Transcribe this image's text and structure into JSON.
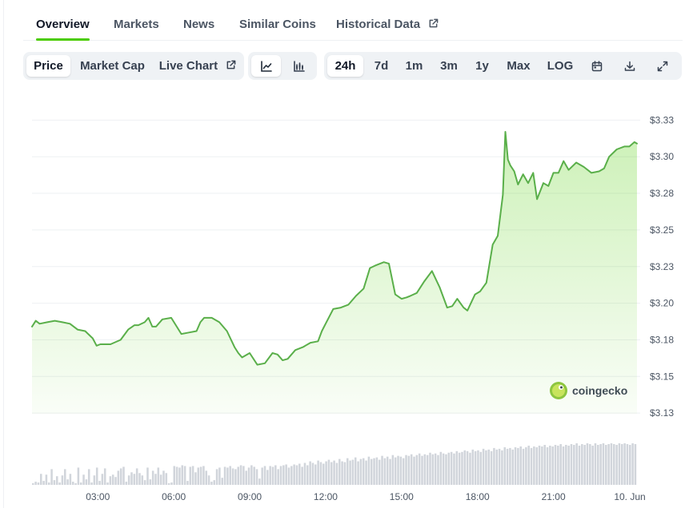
{
  "tabs": [
    {
      "label": "Overview",
      "active": true
    },
    {
      "label": "Markets"
    },
    {
      "label": "News"
    },
    {
      "label": "Similar Coins"
    },
    {
      "label": "Historical Data",
      "icon": "external-link-icon"
    }
  ],
  "toolbar": {
    "metrics": [
      {
        "label": "Price",
        "active": true
      },
      {
        "label": "Market Cap"
      },
      {
        "label": "Live Chart",
        "icon": "external-link-icon"
      }
    ],
    "chart_types": [
      {
        "icon": "line-chart-icon",
        "active": true
      },
      {
        "icon": "candlestick-chart-icon"
      }
    ],
    "ranges": [
      {
        "label": "24h",
        "active": true
      },
      {
        "label": "7d"
      },
      {
        "label": "1m"
      },
      {
        "label": "3m"
      },
      {
        "label": "1y"
      },
      {
        "label": "Max"
      },
      {
        "label": "LOG"
      }
    ],
    "actions": [
      {
        "icon": "calendar-icon"
      },
      {
        "icon": "download-icon"
      },
      {
        "icon": "expand-icon"
      }
    ]
  },
  "watermark": {
    "text": "coingecko",
    "icon": "coingecko-logo-icon"
  },
  "colors": {
    "accent": "#4bcc00",
    "line": "#5aaf4a",
    "area": "#dff3d9",
    "volume": "#d1d5db",
    "grid": "#eef0f3"
  },
  "chart_data": {
    "type": "area",
    "title": "",
    "xlabel": "",
    "ylabel": "",
    "ylim": [
      3.118,
      3.335
    ],
    "y_ticks": [
      "$3.13",
      "$3.15",
      "$3.18",
      "$3.20",
      "$3.23",
      "$3.25",
      "$3.28",
      "$3.30",
      "$3.33"
    ],
    "y_tick_values": [
      3.125,
      3.15,
      3.175,
      3.2,
      3.225,
      3.25,
      3.275,
      3.3,
      3.325
    ],
    "x_ticks": [
      "03:00",
      "06:00",
      "09:00",
      "12:00",
      "15:00",
      "18:00",
      "21:00",
      "10. Jun"
    ],
    "x_tick_values": [
      3,
      6,
      9,
      12,
      15,
      18,
      21,
      24
    ],
    "xlim": [
      0.4,
      24.3
    ],
    "grid": true,
    "legend": "none",
    "series": [
      {
        "x": [
          0.4,
          0.55,
          0.7,
          1.0,
          1.3,
          1.6,
          1.9,
          2.2,
          2.5,
          2.8,
          2.95,
          3.1,
          3.5,
          3.9,
          4.2,
          4.45,
          4.6,
          4.85,
          5.0,
          5.15,
          5.3,
          5.55,
          5.9,
          6.3,
          6.6,
          6.9,
          7.05,
          7.2,
          7.5,
          7.8,
          8.1,
          8.4,
          8.55,
          8.7,
          9.0,
          9.3,
          9.6,
          9.9,
          10.1,
          10.3,
          10.5,
          10.8,
          11.1,
          11.4,
          11.7,
          11.85,
          12.0,
          12.3,
          12.6,
          12.9,
          13.2,
          13.5,
          13.75,
          14.0,
          14.3,
          14.5,
          14.75,
          15.0,
          15.2,
          15.35,
          15.6,
          15.9,
          16.2,
          16.5,
          16.8,
          17.0,
          17.2,
          17.45,
          17.6,
          17.9,
          18.1,
          18.35,
          18.6,
          18.8,
          19.0,
          19.1,
          19.2,
          19.3,
          19.45,
          19.6,
          19.8,
          20.0,
          20.2,
          20.35,
          20.6,
          20.8,
          21.0,
          21.2,
          21.4,
          21.6,
          21.9,
          22.2,
          22.5,
          22.8,
          23.0,
          23.2,
          23.5,
          23.8,
          24.0,
          24.2,
          24.3
        ],
        "y": [
          3.184,
          3.188,
          3.186,
          3.187,
          3.188,
          3.187,
          3.186,
          3.182,
          3.181,
          3.176,
          3.171,
          3.172,
          3.172,
          3.175,
          3.182,
          3.185,
          3.185,
          3.187,
          3.19,
          3.184,
          3.184,
          3.189,
          3.19,
          3.179,
          3.18,
          3.181,
          3.187,
          3.19,
          3.19,
          3.187,
          3.181,
          3.17,
          3.166,
          3.163,
          3.166,
          3.158,
          3.159,
          3.166,
          3.165,
          3.161,
          3.162,
          3.168,
          3.17,
          3.173,
          3.174,
          3.181,
          3.186,
          3.196,
          3.197,
          3.199,
          3.205,
          3.21,
          3.224,
          3.226,
          3.228,
          3.227,
          3.206,
          3.203,
          3.204,
          3.205,
          3.207,
          3.215,
          3.222,
          3.211,
          3.197,
          3.198,
          3.203,
          3.197,
          3.195,
          3.206,
          3.208,
          3.214,
          3.24,
          3.246,
          3.274,
          3.317,
          3.298,
          3.294,
          3.29,
          3.281,
          3.288,
          3.282,
          3.289,
          3.271,
          3.282,
          3.28,
          3.289,
          3.289,
          3.297,
          3.291,
          3.296,
          3.293,
          3.289,
          3.29,
          3.292,
          3.3,
          3.305,
          3.307,
          3.307,
          3.31,
          3.309
        ]
      }
    ],
    "volume": [
      2,
      4,
      3,
      14,
      5,
      13,
      3,
      20,
      6,
      11,
      3,
      12,
      20,
      7,
      14,
      4,
      2,
      22,
      3,
      13,
      7,
      20,
      3,
      12,
      22,
      5,
      14,
      21,
      3,
      11,
      13,
      10,
      18,
      21,
      23,
      4,
      12,
      16,
      14,
      21,
      15,
      12,
      6,
      22,
      7,
      18,
      14,
      22,
      13,
      18,
      15,
      2,
      3,
      24,
      23,
      22,
      25,
      24,
      5,
      23,
      24,
      16,
      22,
      23,
      24,
      18,
      12,
      4,
      6,
      20,
      22,
      9,
      23,
      22,
      24,
      21,
      20,
      23,
      25,
      24,
      18,
      22,
      25,
      23,
      20,
      8,
      22,
      24,
      19,
      24,
      23,
      25,
      20,
      24,
      25,
      26,
      22,
      24,
      26,
      25,
      27,
      23,
      28,
      25,
      30,
      28,
      26,
      31,
      29,
      27,
      30,
      32,
      29,
      31,
      28,
      33,
      30,
      29,
      34,
      31,
      32,
      35,
      30,
      33,
      34,
      31,
      36,
      33,
      34,
      35,
      32,
      37,
      34,
      36,
      33,
      38,
      35,
      37,
      36,
      34,
      38,
      37,
      39,
      36,
      38,
      40,
      37,
      39,
      38,
      41,
      39,
      40,
      38,
      42,
      40,
      39,
      41,
      42,
      40,
      43,
      41,
      42,
      44,
      43,
      41,
      45,
      43,
      44,
      42,
      46,
      44,
      45,
      43,
      47,
      45,
      46,
      44,
      48,
      46,
      47,
      45,
      48,
      47,
      49,
      46,
      48,
      50,
      47,
      49,
      48,
      50,
      49,
      51,
      48,
      50,
      49,
      51,
      50,
      52,
      49,
      51,
      50,
      52,
      51,
      53,
      50,
      52,
      51,
      53,
      52,
      50,
      53,
      51,
      52,
      53,
      51,
      52,
      53,
      52,
      51,
      53,
      52,
      53,
      52,
      51,
      53,
      52
    ]
  }
}
